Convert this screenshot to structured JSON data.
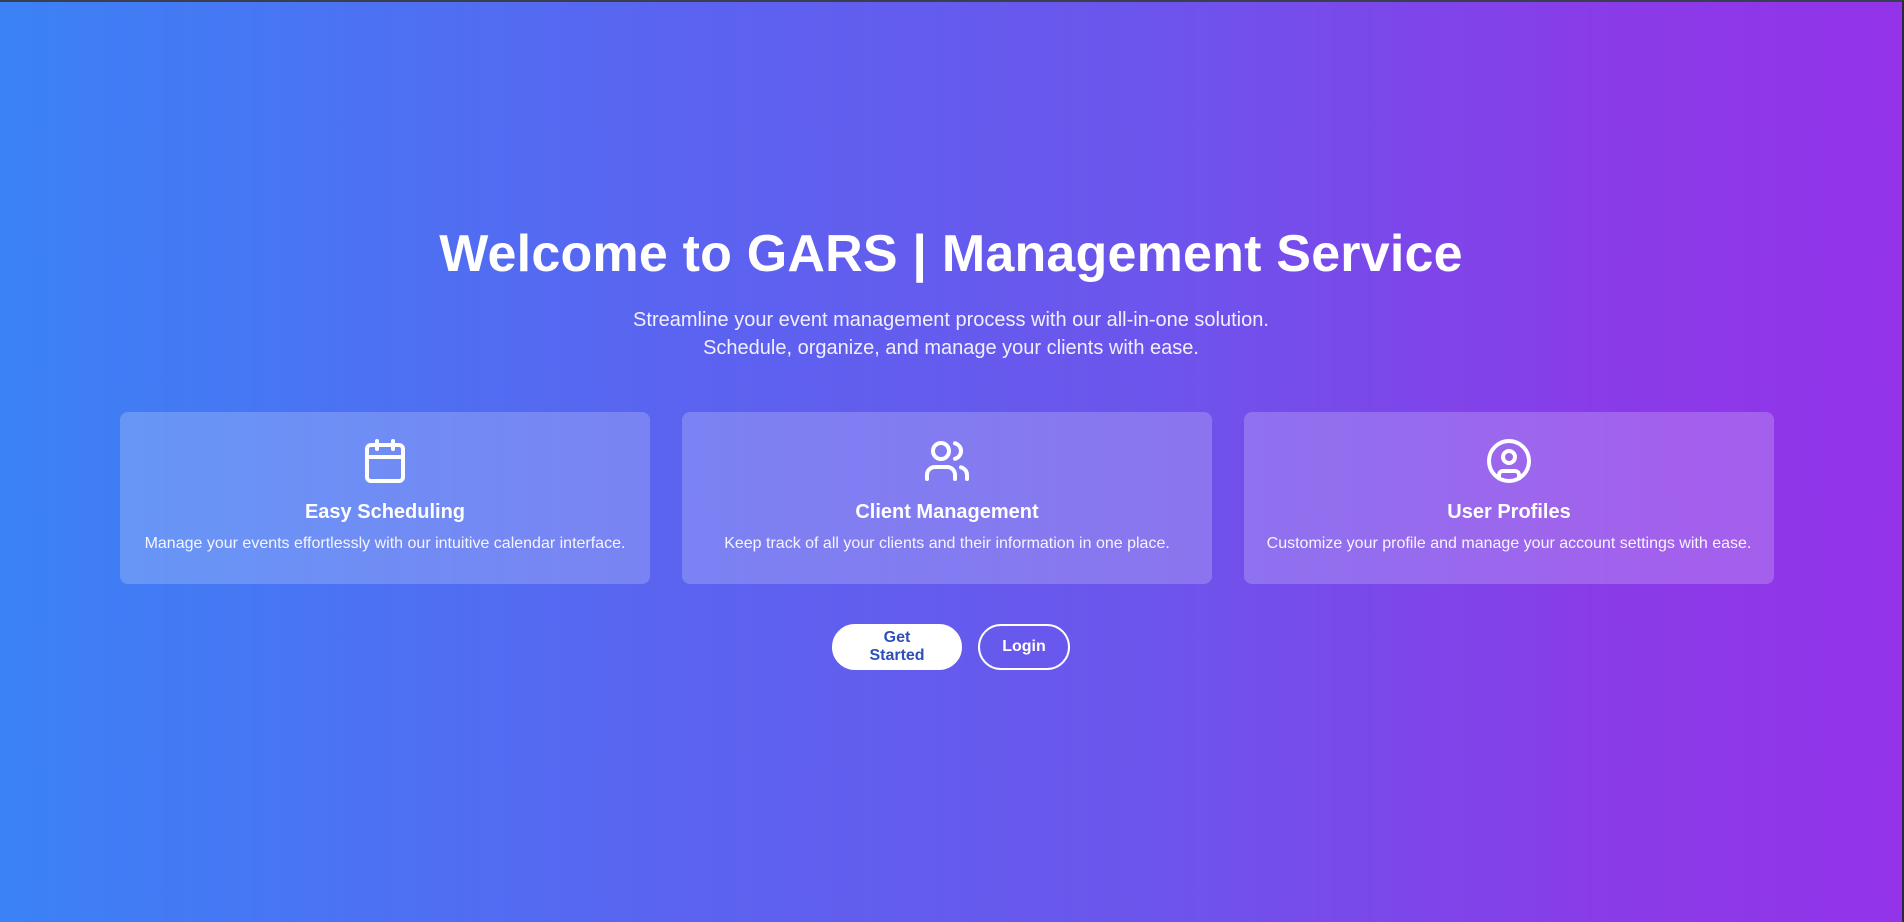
{
  "hero": {
    "title": "Welcome to GARS | Management Service",
    "subtitle_line1": "Streamline your event management process with our all-in-one solution.",
    "subtitle_line2": "Schedule, organize, and manage your clients with ease."
  },
  "features": [
    {
      "icon": "calendar-icon",
      "title": "Easy Scheduling",
      "description": "Manage your events effortlessly with our intuitive calendar interface."
    },
    {
      "icon": "users-icon",
      "title": "Client Management",
      "description": "Keep track of all your clients and their information in one place."
    },
    {
      "icon": "user-circle-icon",
      "title": "User Profiles",
      "description": "Customize your profile and manage your account settings with ease."
    }
  ],
  "actions": {
    "get_started_label": "Get Started",
    "login_label": "Login"
  },
  "colors": {
    "gradient_start": "#3b82f6",
    "gradient_end": "#9333ea",
    "primary_button_text": "#2f4fb8"
  }
}
